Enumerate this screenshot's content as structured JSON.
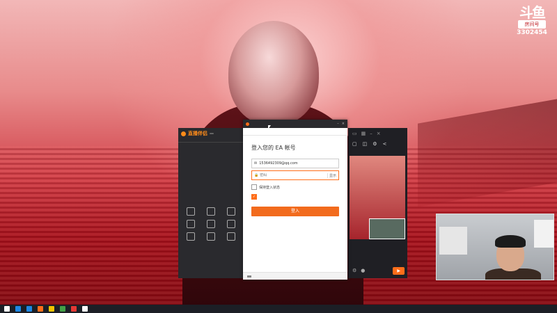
{
  "overlay": {
    "ticker_lines": [
      "",
      ""
    ],
    "logo": {
      "mark": "斗鱼",
      "room_label": "房间号",
      "room_number": "3302454"
    }
  },
  "client": {
    "brand": "直播伴侣",
    "version": "",
    "tabs": [
      "",
      "",
      ""
    ],
    "list": [
      "",
      "",
      "",
      "",
      "",
      "",
      ""
    ],
    "tools_title": "",
    "tools": [
      "",
      "",
      "",
      "",
      "",
      "",
      "",
      "",
      ""
    ],
    "footer": ""
  },
  "login": {
    "window_title": "",
    "tabs": [
      "",
      ""
    ],
    "heading": "登入您的 EA 帐号",
    "email_value": "1536492309@qq.com",
    "password_placeholder": "密码",
    "show_label": "显示",
    "remember_label": "保持登入状态",
    "agree_label": "",
    "login_button": "登入",
    "forgot_link": "",
    "footer": ""
  },
  "taskbar": {
    "time": "",
    "date": "",
    "app_icon_colors": [
      "#ffffff",
      "#1e88e5",
      "#1e88e5",
      "#ff6e1a",
      "#f2c400",
      "#43a047",
      "#e53935",
      "#ffffff"
    ]
  }
}
